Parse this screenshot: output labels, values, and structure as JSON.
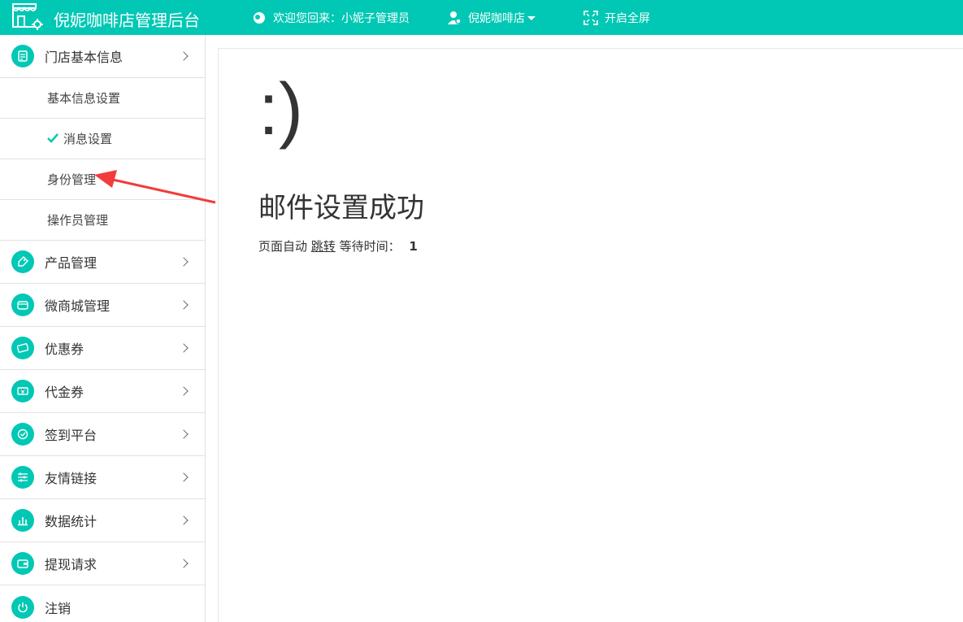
{
  "header": {
    "title": "倪妮咖啡店管理后台",
    "welcome": "欢迎您回来：小妮子管理员",
    "store": "倪妮咖啡店",
    "fullscreen": "开启全屏",
    "accent": "#00c8b4"
  },
  "sidebar": {
    "store_info": "门店基本信息",
    "sub": [
      "基本信息设置",
      "消息设置",
      "身份管理",
      "操作员管理"
    ],
    "items": [
      "产品管理",
      "微商城管理",
      "优惠券",
      "代金券",
      "签到平台",
      "友情链接",
      "数据统计",
      "提现请求",
      "注销"
    ]
  },
  "main": {
    "smiley": ":)",
    "message": "邮件设置成功",
    "jump_prefix": "页面自动",
    "jump_link": "跳转",
    "wait_label": "等待时间：",
    "wait_value": "1"
  }
}
